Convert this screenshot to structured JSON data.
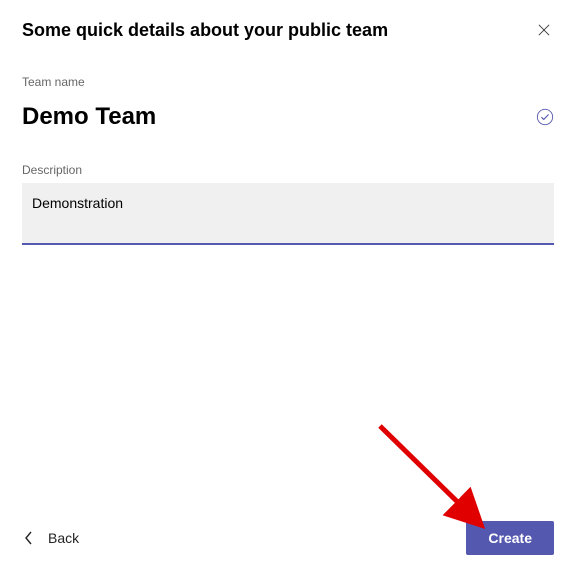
{
  "title": "Some quick details about your public team",
  "labels": {
    "team_name": "Team name",
    "description": "Description"
  },
  "fields": {
    "team_name_value": "Demo Team",
    "description_value": "Demonstration"
  },
  "buttons": {
    "back": "Back",
    "create": "Create"
  },
  "colors": {
    "accent": "#5558af"
  }
}
